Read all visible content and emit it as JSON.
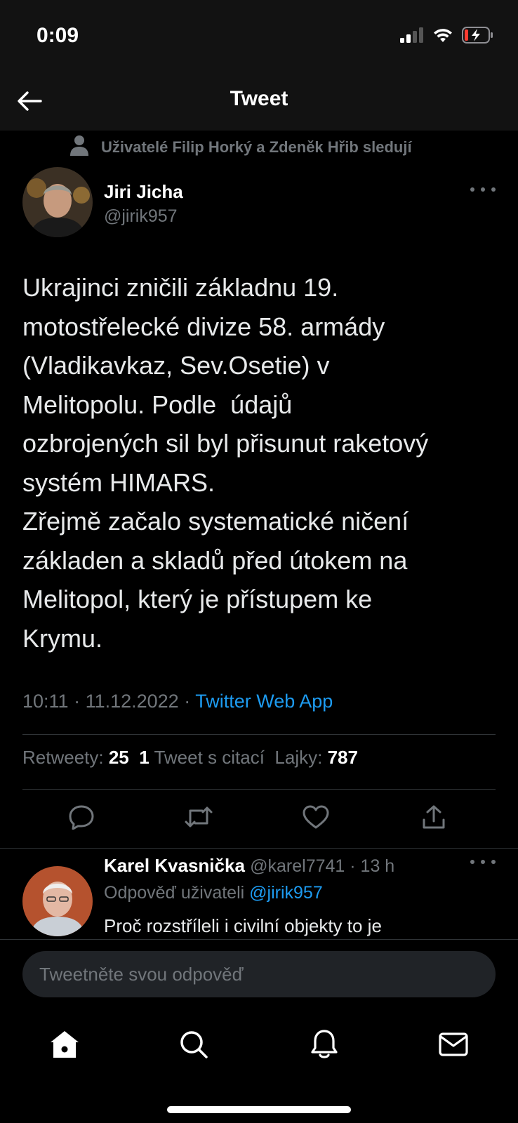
{
  "status_bar": {
    "time": "0:09",
    "icons": [
      "signal-icon",
      "wifi-icon",
      "battery-charging-icon"
    ]
  },
  "nav": {
    "title": "Tweet",
    "back_icon": "arrow-left-icon"
  },
  "tweet": {
    "social_context": "Uživatelé Filip Horký a Zdeněk Hřib sledují",
    "author": {
      "name": "Jiri Jicha",
      "handle": "@jirik957"
    },
    "text": "Ukrajinci zničili základnu 19.\nmotostřelecké divize 58. armády\n(Vladikavkaz, Sev.Osetie) v\nMelitopolu. Podle  údajů\nozbrojených sil byl přisunut raketový\nsystém HIMARS.\nZřejmě začalo systematické ničení\nzákladen a skladů před útokem na\nMelitopol, který je přístupem ke\nKrymu.",
    "time": "10:11",
    "date": "11.12.2022",
    "source": "Twitter Web App",
    "stats": {
      "retweets_label": "Retweety:",
      "retweets": "25",
      "quotes": "1",
      "quotes_label": "Tweet s citací",
      "likes_label": "Lajky:",
      "likes": "787"
    },
    "actions": [
      "reply-icon",
      "retweet-icon",
      "like-icon",
      "share-icon"
    ]
  },
  "reply": {
    "name": "Karel Kvasnička",
    "handle": "@karel7741",
    "time": "13 h",
    "replying_to_label": "Odpověď uživateli",
    "replying_to_handle": "@jirik957",
    "text_partial": "Proč rozstříleli i civilní objekty to je"
  },
  "compose": {
    "placeholder": "Tweetněte svou odpověď"
  },
  "tabs": [
    "home-icon",
    "search-icon",
    "bell-icon",
    "mail-icon"
  ],
  "colors": {
    "accent": "#1d9bf0",
    "background": "#000000",
    "secondary_text": "#71767b"
  }
}
